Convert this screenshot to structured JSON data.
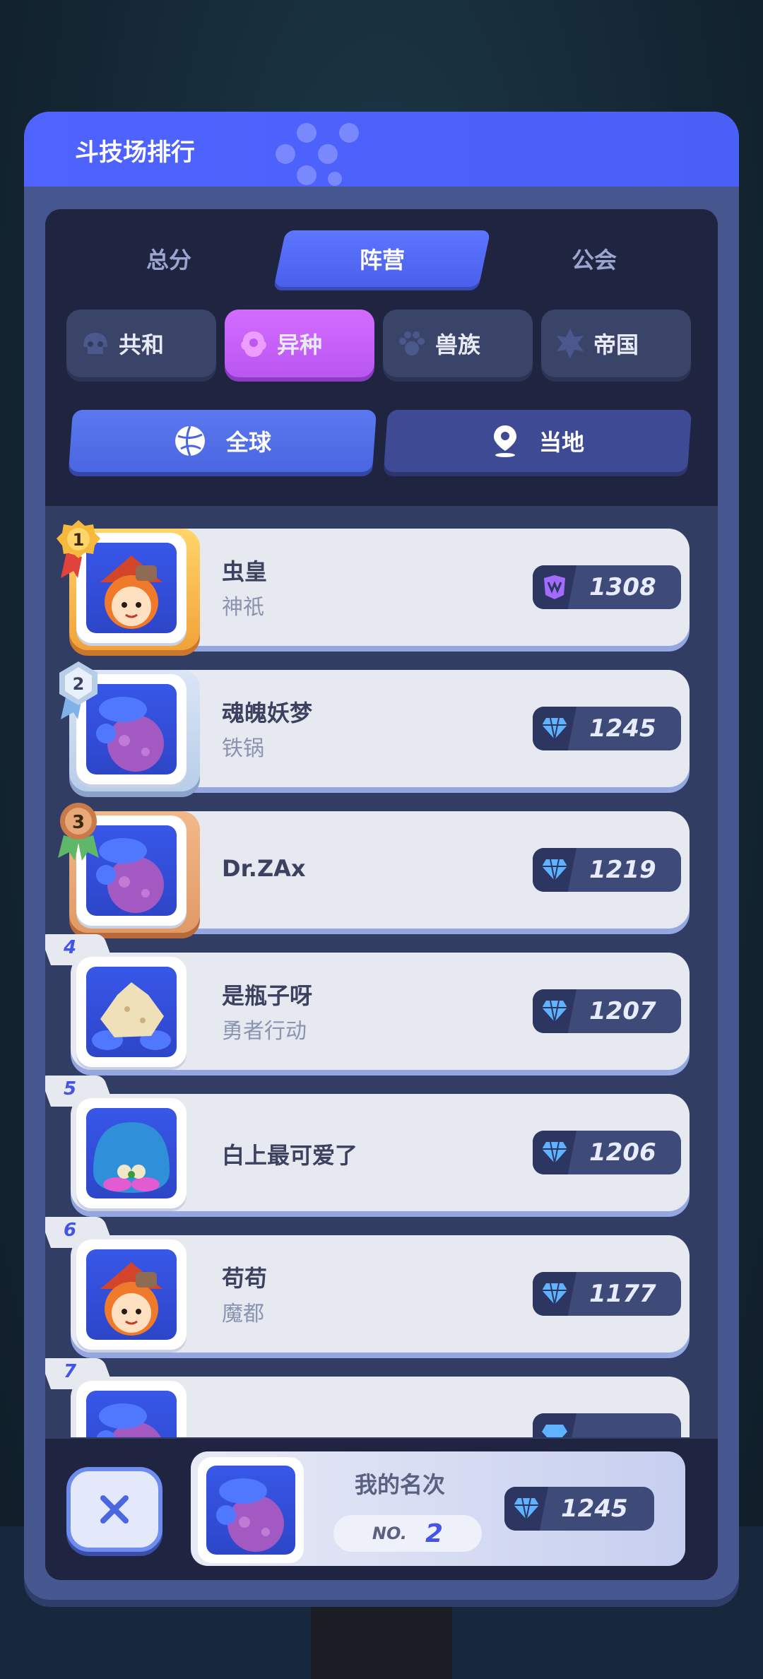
{
  "panel": {
    "title": "斗技场排行"
  },
  "tabs": [
    {
      "label": "总分",
      "active": false
    },
    {
      "label": "阵营",
      "active": true
    },
    {
      "label": "公会",
      "active": false
    }
  ],
  "factions": [
    {
      "label": "共和",
      "icon": "republic-icon",
      "active": false
    },
    {
      "label": "异种",
      "icon": "mutant-icon",
      "active": true
    },
    {
      "label": "兽族",
      "icon": "paw-icon",
      "active": false
    },
    {
      "label": "帝国",
      "icon": "empire-icon",
      "active": false
    }
  ],
  "regions": [
    {
      "label": "全球",
      "icon": "globe-icon",
      "active": true
    },
    {
      "label": "当地",
      "icon": "location-pin-icon",
      "active": false
    }
  ],
  "ranking": [
    {
      "rank": "1",
      "name": "虫皇",
      "sub": "神祇",
      "score": "1308",
      "avatar": "witch-girl",
      "tier_icon": "purple-crest-icon"
    },
    {
      "rank": "2",
      "name": "魂魄妖梦",
      "sub": "铁锅",
      "score": "1245",
      "avatar": "purple-octopus",
      "tier_icon": "diamond-icon"
    },
    {
      "rank": "3",
      "name": "Dr.ZAx",
      "sub": "",
      "score": "1219",
      "avatar": "purple-octopus",
      "tier_icon": "diamond-icon"
    },
    {
      "rank": "4",
      "name": "是瓶子呀",
      "sub": "勇者行动",
      "score": "1207",
      "avatar": "rock-crab",
      "tier_icon": "diamond-icon"
    },
    {
      "rank": "5",
      "name": "白上最可爱了",
      "sub": "",
      "score": "1206",
      "avatar": "blue-blob",
      "tier_icon": "diamond-icon"
    },
    {
      "rank": "6",
      "name": "苟苟",
      "sub": "魔都",
      "score": "1177",
      "avatar": "witch-girl",
      "tier_icon": "diamond-icon"
    },
    {
      "rank": "7",
      "name": "",
      "sub": "",
      "score": "",
      "avatar": "purple-octopus",
      "tier_icon": "diamond-icon"
    }
  ],
  "my_rank": {
    "title": "我的名次",
    "no_label": "NO.",
    "no_value": "2",
    "score": "1245"
  },
  "colors": {
    "header": "#4f63ff",
    "gold": "#f6b93b",
    "silver": "#b8cde8",
    "bronze": "#e09a66",
    "faction_active": "#c85ff5"
  }
}
